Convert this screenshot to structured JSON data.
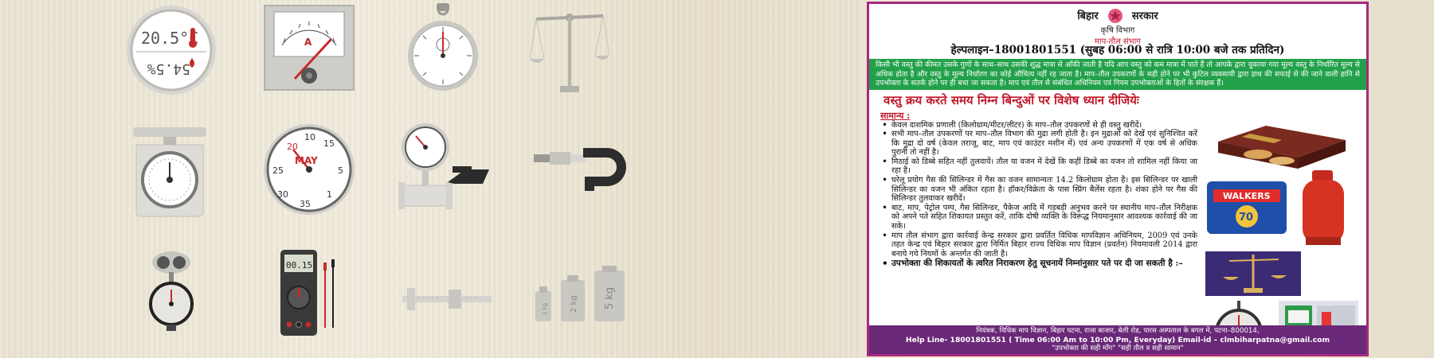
{
  "gallery": {
    "icons": [
      "thermo-hygrometer-icon",
      "ammeter-icon",
      "stopwatch-icon",
      "balance-scale-icon",
      "kitchen-scale-icon",
      "pressure-gauge-icon",
      "flow-meter-icon",
      "micrometer-icon",
      "hanging-scale-icon",
      "multimeter-icon",
      "vernier-caliper-icon",
      "weights-icon"
    ],
    "thermo": {
      "temp": "20.5°C",
      "humidity": "54.5%"
    },
    "ammeter_unit": "A",
    "gauge": {
      "label": "MAY",
      "ticks": [
        "10",
        "15",
        "20",
        "25",
        "30",
        "35",
        "5",
        "1"
      ]
    },
    "multimeter_reading": "00.15",
    "weights": [
      "1 kg",
      "2 kg",
      "5 kg"
    ]
  },
  "poster": {
    "govt_left": "बिहार",
    "govt_right": "सरकार",
    "dept": "कृषि विभाग",
    "subdept": "माप-तौल संभाग",
    "helpline": "हेल्पलाइन–18001801551 (सुबह 06:00 से रात्रि 10:00 बजे तक प्रतिदिन)",
    "intro": "किसी भी वस्तु की कीमत उसके गुणों के साथ–साथ उसकी शुद्ध मात्रा से आँकी जाती है यदि आप वस्तु को कम मात्रा में पाते हैं तो आपके द्वारा चुकाया गया मूल्य वस्तु के निर्धारित मूल्य से अधिक होता है और वस्तु के मूल्य निर्धारण का कोई औचित्य नहीं रह जाता है। माप–तौल उपकरणों के सही होने पर भी कुटिल व्यवसायी द्वारा हाथ की सफाई से की जाने वाली हानि से उपभोक्ता के सतर्क होने पर ही बचा जा सकता है। माप एवं तौल से संबंधित अधिनियम एवं नियम उपभोक्ताओं के हितों के संरक्षक हैं।",
    "headline": "वस्तु क्रय करते समय निम्न बिन्दुओं पर विशेष ध्यान दीजियेः",
    "section": "सामान्य :",
    "bullets": [
      "केवल दाशमिक प्रणाली (किलोग्राम/मीटर/लीटर) के माप–तौल उपकरणों से ही वस्तु खरीदें।",
      "सभी माप–तौल उपकरणों पर माप–तौल विभाग की मुद्रा लगी होती है। इन मुद्राओं को देखें एवं सुनिश्चित करें कि मुद्रा दो वर्ष (केवल तराजू, बाट, माप एवं काउंटर मशीन में) एवं अन्य उपकरणों में एक वर्ष से अधिक पुरानी तो नहीं है।",
      "मिठाई को डिब्बे सहित नहीं तुलवायें। तौल या वजन में देखें कि कहीं डिब्बे का वजन तो शामिल नहीं किया जा रहा है।",
      "घरेलू प्रयोग गैस की सिलिन्डर में गैस का वजन सामान्यतः 14.2 किलोग्राम होता है। इस सिलिन्डर पर खाली सिलिन्डर का वजन भी अंकित रहता है। हॉकर/विक्रेता के पास स्प्रिंग बैलेंस रहता है। शंका होने पर गैस की सिलिन्डर तुलवाकर खरीदें।",
      "बाट, माप, पेट्रोल पम्प, गैस सिलिन्डर, पैकेज आदि में गड़बड़ी अनुभव करने पर स्थानीय माप–तौल निरीक्षक को अपने पते सहित शिकायत प्रस्तुत करें, ताकि दोषी व्यक्ति के विरूद्ध नियमानुसार आवश्यक कार्रवाई की जा सके।",
      "माप तौल संभाग द्वारा कार्रवाई केन्द्र सरकार द्वारा प्रवर्तित विधिक मापविज्ञान अधिनियम, 2009 एवं उनके तहत केन्द्र एवं बिहार सरकार द्वारा निर्मित बिहार राज्य विधिक माप विज्ञान (प्रवर्तन) नियमावली 2014 द्वारा बनाये गये नियमों के अन्तर्गत की जाती है।",
      "उपभोक्ता की शिकायतों के त्वरित निराकरण हेतु सूचनायें निम्नांनुसार पते पर दी जा सकती है :–"
    ],
    "product_labels": {
      "chips_brand": "WALKERS",
      "chips_count": "70"
    },
    "footer_line1": "नियंत्रक, विधिक माप विज्ञान, बिहार पटना, राजा बाजार, बेली रोड, पारस अस्पताल के बगल में, पटना–800014,",
    "footer_line2": "Help Line- 18001801551 ( Time 06:00 Am to 10:00 Pm, Everyday) Email-id – clmbiharpatna@gmail.com",
    "footer_line3": "\"उपभोक्ता की सही माँग\" \"सही तौल व सही सामान\""
  },
  "colors": {
    "poster_border": "#a6297e",
    "intro_bg": "#22a14a",
    "headline": "#c2182b",
    "footer_bg": "#6a2878"
  }
}
